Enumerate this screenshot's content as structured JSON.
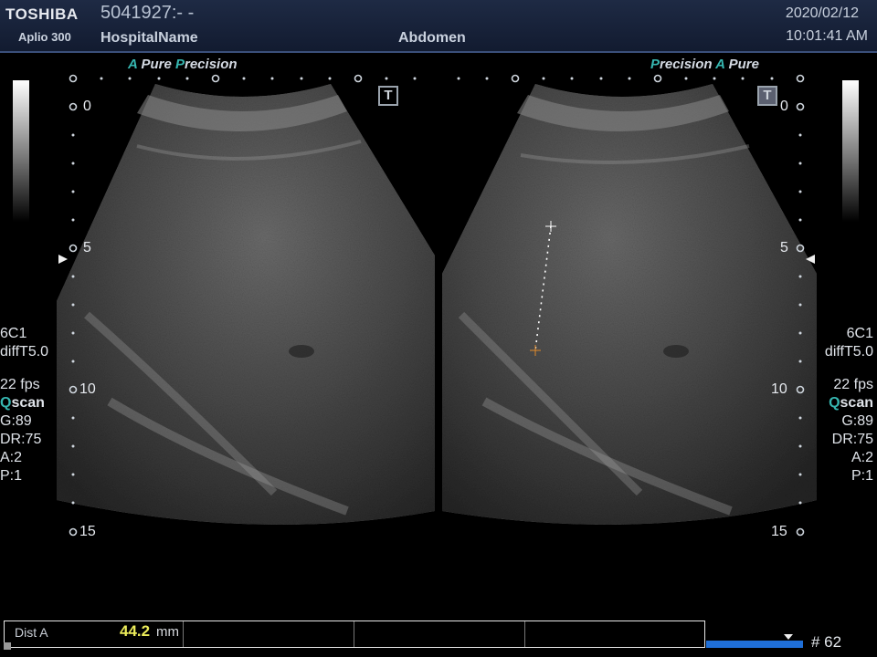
{
  "header": {
    "brand": "TOSHIBA",
    "model": "Aplio 300",
    "patient_id": "5041927:- -",
    "hospital": "HospitalName",
    "exam": "Abdomen",
    "date": "2020/02/12",
    "time": "10:01:41 AM"
  },
  "tags": {
    "left": {
      "a": "A",
      "pure": "Pure",
      "p": "P",
      "recision": "recision"
    },
    "right": {
      "p": "P",
      "recision": "recision",
      "a": "A",
      "pure": "Pure"
    }
  },
  "icons": {
    "t_left": "T",
    "t_right": "T"
  },
  "depth_scale": {
    "left": [
      "0",
      "5",
      "10",
      "15"
    ],
    "right": [
      "0",
      "5",
      "10",
      "15"
    ]
  },
  "params": {
    "probe": "6C1",
    "preset": "diffT5.0",
    "fps": "22 fps",
    "q": "Q",
    "scan": "scan",
    "gain": "G:89",
    "dr": "DR:75",
    "a": "A:2",
    "p": "P:1"
  },
  "measurement": {
    "label": "Dist A",
    "value": "44.2",
    "unit": "mm"
  },
  "cine": {
    "frame": "# 62"
  },
  "colors": {
    "accent": "#36b6b0",
    "header_bg": "#1a2440",
    "value": "#ecec5a",
    "cine": "#1f6fd8"
  }
}
